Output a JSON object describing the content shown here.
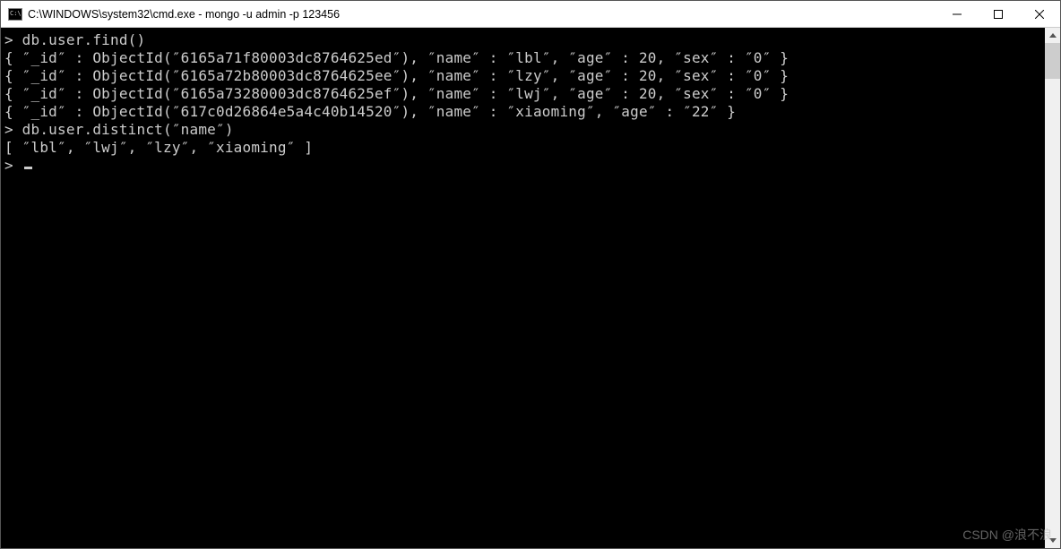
{
  "titlebar": {
    "text": "C:\\WINDOWS\\system32\\cmd.exe - mongo  -u admin -p 123456"
  },
  "console": {
    "lines": [
      "> db.user.find()",
      "{ ″_id″ : ObjectId(″6165a71f80003dc8764625ed″), ″name″ : ″lbl″, ″age″ : 20, ″sex″ : ″0″ }",
      "{ ″_id″ : ObjectId(″6165a72b80003dc8764625ee″), ″name″ : ″lzy″, ″age″ : 20, ″sex″ : ″0″ }",
      "{ ″_id″ : ObjectId(″6165a73280003dc8764625ef″), ″name″ : ″lwj″, ″age″ : 20, ″sex″ : ″0″ }",
      "{ ″_id″ : ObjectId(″617c0d26864e5a4c40b14520″), ″name″ : ″xiaoming″, ″age″ : ″22″ }",
      "> db.user.distinct(″name″)",
      "[ ″lbl″, ″lwj″, ″lzy″, ″xiaoming″ ]",
      "> "
    ]
  },
  "watermark": "CSDN @浪不浪"
}
